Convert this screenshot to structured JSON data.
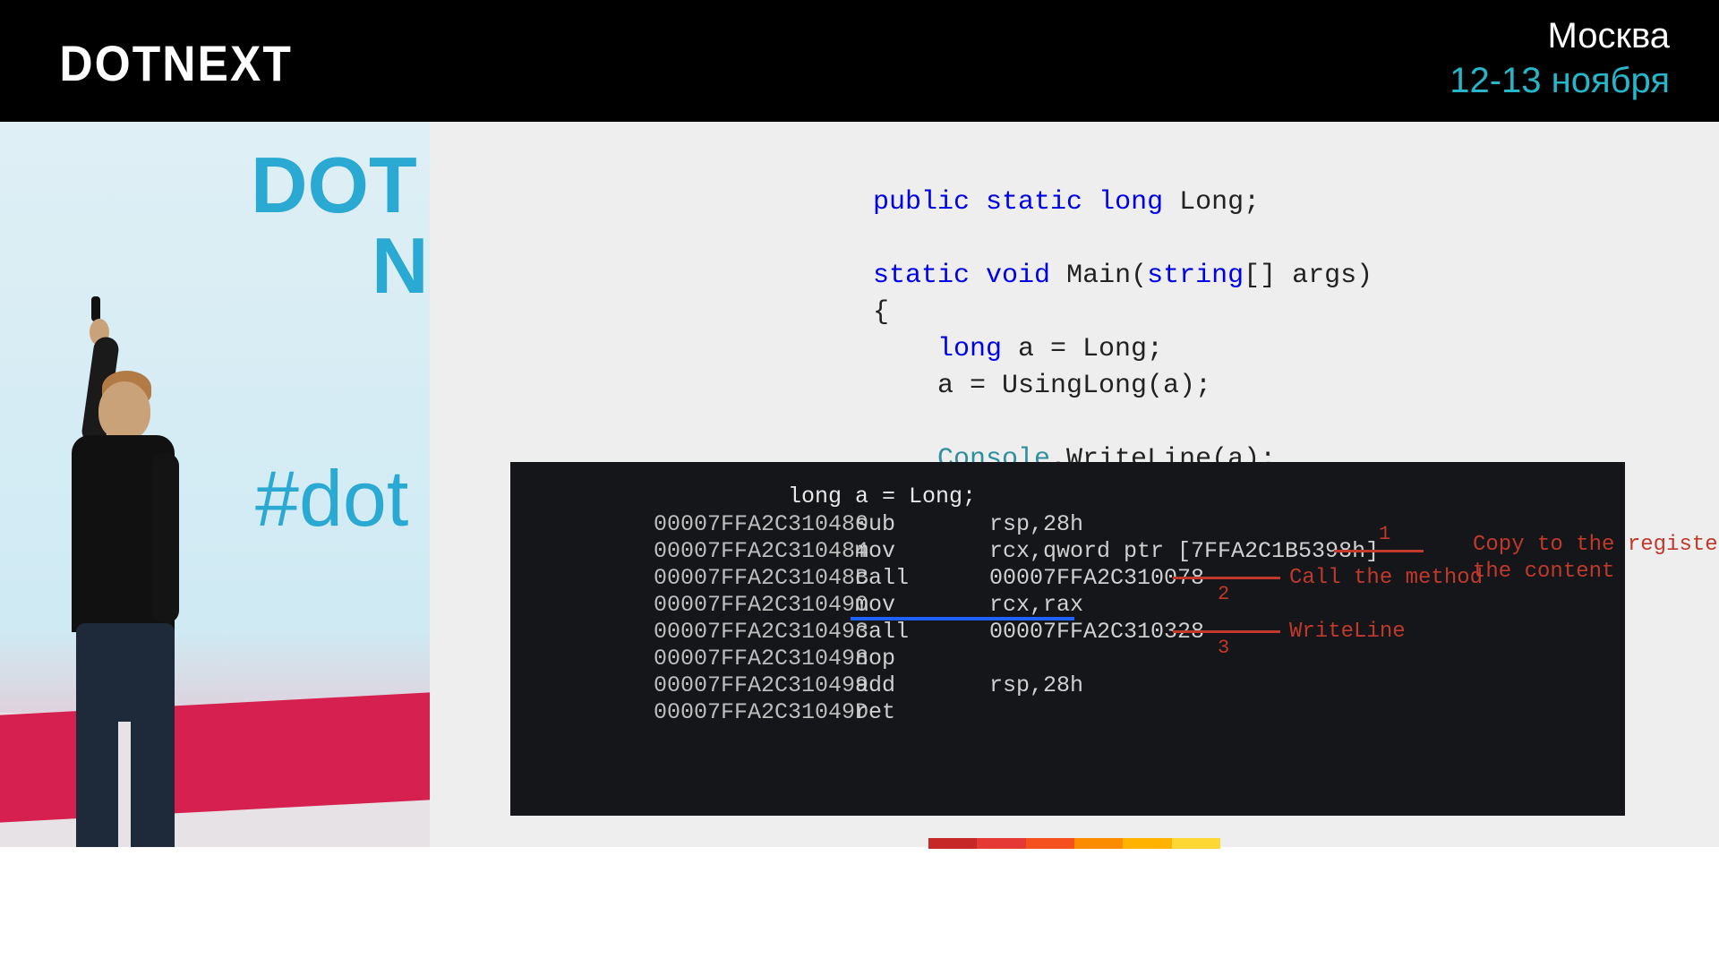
{
  "header": {
    "brand": "DOTNEXT",
    "city": "Москва",
    "dates": "12-13 ноября"
  },
  "camera_background": {
    "partial_logo_top": "DOT",
    "partial_logo_bottom": "NE",
    "hashtag": "#dot"
  },
  "source_code": {
    "l1_kw1": "public",
    "l1_kw2": "static",
    "l1_kw3": "long",
    "l1_ident": " Long;",
    "l2_kw1": "static",
    "l2_kw2": "void",
    "l2_name": " Main(",
    "l2_ty": "string",
    "l2_rest": "[] args)",
    "l3": "{",
    "l4_kw": "long",
    "l4_rest": " a = Long;",
    "l5": "    a = UsingLong(a);",
    "l6_cls": "Console",
    "l6_rest": ".WriteLine(a);",
    "l7": "}"
  },
  "asm": {
    "title": "long a = Long;",
    "rows": [
      {
        "addr": "00007FFA2C310480",
        "op": "sub",
        "arg": "rsp,28h"
      },
      {
        "addr": "00007FFA2C310484",
        "op": "mov",
        "arg": "rcx,qword ptr [7FFA2C1B5398h]"
      },
      {
        "addr": "00007FFA2C31048B",
        "op": "call",
        "arg": "00007FFA2C310078"
      },
      {
        "addr": "00007FFA2C310490",
        "op": "mov",
        "arg": "rcx,rax"
      },
      {
        "addr": "00007FFA2C310493",
        "op": "call",
        "arg": "00007FFA2C310328"
      },
      {
        "addr": "00007FFA2C310498",
        "op": "nop",
        "arg": ""
      },
      {
        "addr": "00007FFA2C310499",
        "op": "add",
        "arg": "rsp,28h"
      },
      {
        "addr": "00007FFA2C31049D",
        "op": "ret",
        "arg": ""
      }
    ],
    "annotations": {
      "n1": "1",
      "n2": "2",
      "n3": "3",
      "text1": "Copy to the register\nthe content",
      "text2": "Call the method",
      "text3": "WriteLine"
    }
  },
  "strip_colors": [
    "#c62828",
    "#e53935",
    "#f4511e",
    "#fb8c00",
    "#ffb300",
    "#fdd835"
  ]
}
